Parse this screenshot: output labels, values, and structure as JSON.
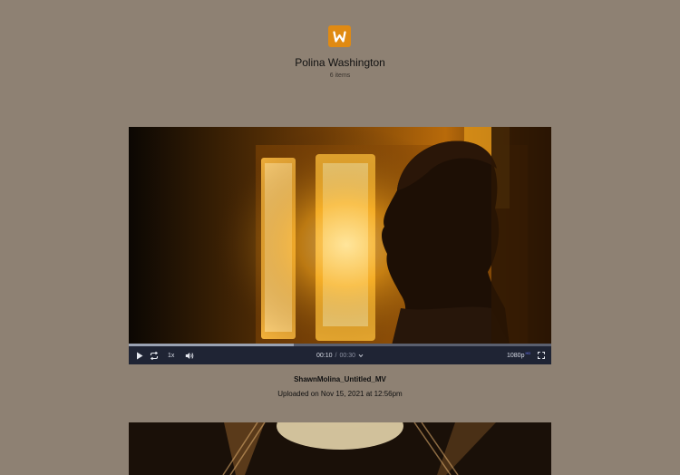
{
  "header": {
    "logo_icon": "w-logo-icon",
    "title": "Polina Washington",
    "item_count": "6 items"
  },
  "player": {
    "progress": 0.39,
    "speed_label": "1x",
    "current_time": "00:10",
    "separator": "/",
    "duration": "00:30",
    "quality_label": "1080p",
    "quality_tag": "HD",
    "icons": {
      "play": "play-icon",
      "loop": "loop-icon",
      "volume": "volume-icon",
      "chevron": "chevron-down-icon",
      "fullscreen": "fullscreen-icon"
    }
  },
  "video": {
    "filename": "ShawnMolina_Untitled_MV",
    "uploaded": "Uploaded on Nov 15, 2021 at 12:56pm"
  },
  "colors": {
    "background": "#8e8173",
    "accent": "#e08a12",
    "controls_bg": "#1f2434"
  }
}
